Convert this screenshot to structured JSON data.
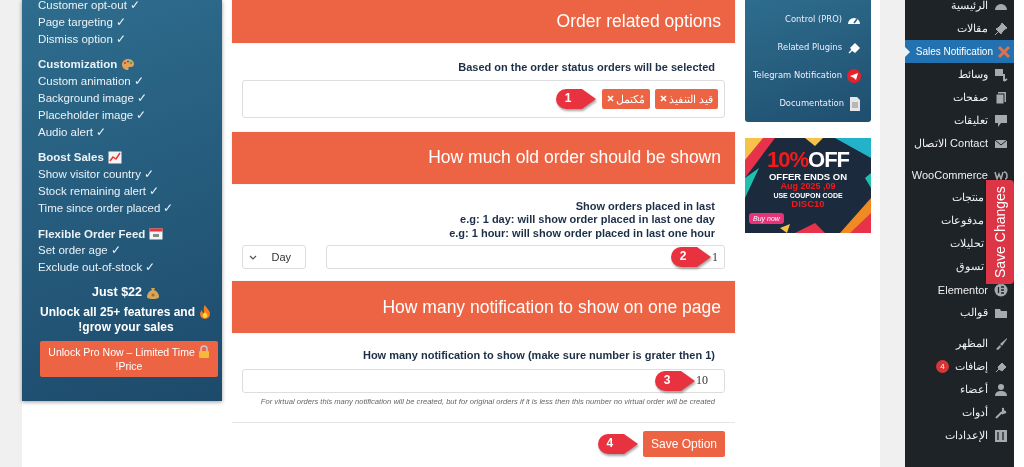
{
  "promo_panel": {
    "groups": [
      {
        "items": [
          "Customer opt-out ✓",
          "Page targeting ✓",
          "Dismiss option ✓"
        ]
      },
      {
        "heading": "Customization",
        "items": [
          "Custom animation ✓",
          "Background image ✓",
          "Placeholder image ✓",
          "Audio alert ✓"
        ]
      },
      {
        "heading": "Boost Sales",
        "items": [
          "Show visitor country ✓",
          "Stock remaining alert ✓",
          "Time since order placed ✓"
        ]
      },
      {
        "heading": "Flexible Order Feed",
        "items": [
          "Set order age ✓",
          "Exclude out-of-stock ✓"
        ]
      }
    ],
    "price": "Just $22",
    "headline_lines": [
      "Unlock all 25+ features and",
      "!grow your sales"
    ],
    "button_lines": [
      "Unlock Pro Now – Limited Time",
      "!Price"
    ]
  },
  "sections": [
    {
      "kind": "tags",
      "title": "Order related options",
      "labels": [
        "Based on the order status orders will be selected"
      ],
      "tags": [
        "قيد التنفيذ",
        "مُكتمل"
      ],
      "callout": "1"
    },
    {
      "kind": "duration",
      "title": "How much old order should be shown",
      "labels": [
        "Show orders placed in last",
        "e.g: 1 day: will show order placed in last one day",
        "e.g: 1 hour: will show order placed in last one hour"
      ],
      "unit": "Day",
      "value": "1",
      "callout": "2"
    },
    {
      "kind": "count",
      "title": "How many notification to show on one page",
      "labels": [
        "How many notification to show (make sure number is grater then 1)"
      ],
      "value": "10",
      "callout": "3",
      "help": "For virtual orders this many notification will be created, but for original orders if it is less then this number no virtual order will be created"
    }
  ],
  "save": {
    "label": "Save Option",
    "callout": "4"
  },
  "side_links": [
    "Control (PRO)",
    "Related Plugins",
    "Telegram Notification",
    "Documentation"
  ],
  "banner": {
    "percent": "10%",
    "off": "OFF",
    "line1": "OFFER ENDS ON",
    "date": "Aug 2025 ,09",
    "line2": "USE COUPON CODE",
    "code": "DISC10",
    "buy": "Buy now"
  },
  "admin_menu": {
    "groups": [
      [
        {
          "label": "الرئيسية",
          "selected": false
        },
        {
          "label": "مقالات",
          "selected": false
        },
        {
          "label": "Sales Notification",
          "selected": true
        },
        {
          "label": "وسائط",
          "selected": false
        },
        {
          "label": "صفحات",
          "selected": false
        },
        {
          "label": "تعليقات",
          "selected": false
        },
        {
          "label": "الاتصال Contact",
          "selected": false
        }
      ],
      [
        {
          "label": "WooCommerce",
          "selected": false
        },
        {
          "label": "منتجات",
          "selected": false
        },
        {
          "label": "مدفوعات",
          "selected": false
        },
        {
          "label": "تحليلات",
          "selected": false
        },
        {
          "label": "تسوق",
          "selected": false
        },
        {
          "label": "Elementor",
          "selected": false
        },
        {
          "label": "قوالب",
          "selected": false
        }
      ],
      [
        {
          "label": "المظهر",
          "selected": false
        },
        {
          "label": "إضافات",
          "selected": false,
          "badge": "4"
        },
        {
          "label": "أعضاء",
          "selected": false
        },
        {
          "label": "أدوات",
          "selected": false
        },
        {
          "label": "الإعدادات",
          "selected": false
        }
      ]
    ]
  },
  "save_changes_tab": "Save Changes"
}
